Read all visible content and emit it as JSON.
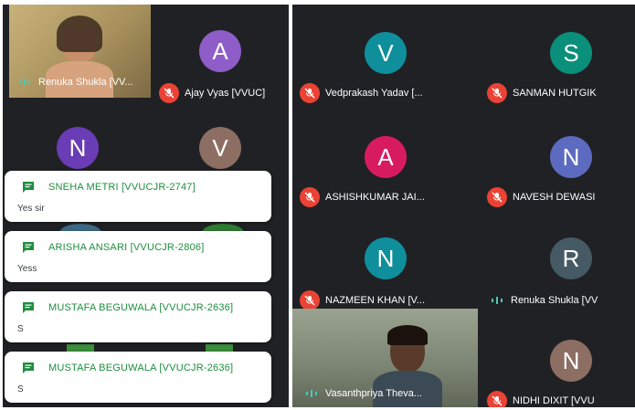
{
  "colors": {
    "background": "#202124",
    "mic_off": "#ea4335",
    "chat_accent": "#1e8e3e"
  },
  "left_grid": [
    {
      "name": "Renuka Shukla [VV...",
      "type": "video",
      "mic": "on"
    },
    {
      "name": "Ajay Vyas [VVUC]",
      "initial": "A",
      "color": "#8e5dc7",
      "mic": "off"
    },
    {
      "name": "",
      "initial": "N",
      "color": "#6a3cb5",
      "mic": "off"
    },
    {
      "name": "",
      "initial": "V",
      "color": "#8d6e63",
      "mic": "off"
    }
  ],
  "right_grid": [
    {
      "name": "Vedprakash Yadav [...",
      "initial": "V",
      "color": "#0f8f9c",
      "mic": "off"
    },
    {
      "name": "SANMAN HUTGIK",
      "initial": "S",
      "color": "#0a8f7a",
      "mic": "off"
    },
    {
      "name": "ASHISHKUMAR JAI...",
      "initial": "A",
      "color": "#d81b60",
      "mic": "off"
    },
    {
      "name": "NAVESH DEWASI",
      "initial": "N",
      "color": "#5c6bc0",
      "mic": "off"
    },
    {
      "name": "NAZMEEN KHAN [V...",
      "initial": "N",
      "color": "#0f8f9c",
      "mic": "off"
    },
    {
      "name": "Renuka Shukla [VV",
      "initial": "R",
      "color": "#455a64",
      "mic": "on"
    },
    {
      "name": "Vasanthpriya Theva...",
      "type": "video",
      "mic": "on"
    },
    {
      "name": "NIDHI DIXIT [VVU",
      "initial": "N",
      "color": "#8d6e63",
      "mic": "off"
    }
  ],
  "chat_notifications": [
    {
      "sender": "SNEHA METRI [VVUCJR-2747]",
      "message": "Yes sir"
    },
    {
      "sender": "ARISHA ANSARI [VVUCJR-2806]",
      "message": "Yess"
    },
    {
      "sender": "MUSTAFA BEGUWALA [VVUCJR-2636]",
      "message": "S"
    },
    {
      "sender": "MUSTAFA BEGUWALA [VVUCJR-2636]",
      "message": "S"
    }
  ]
}
